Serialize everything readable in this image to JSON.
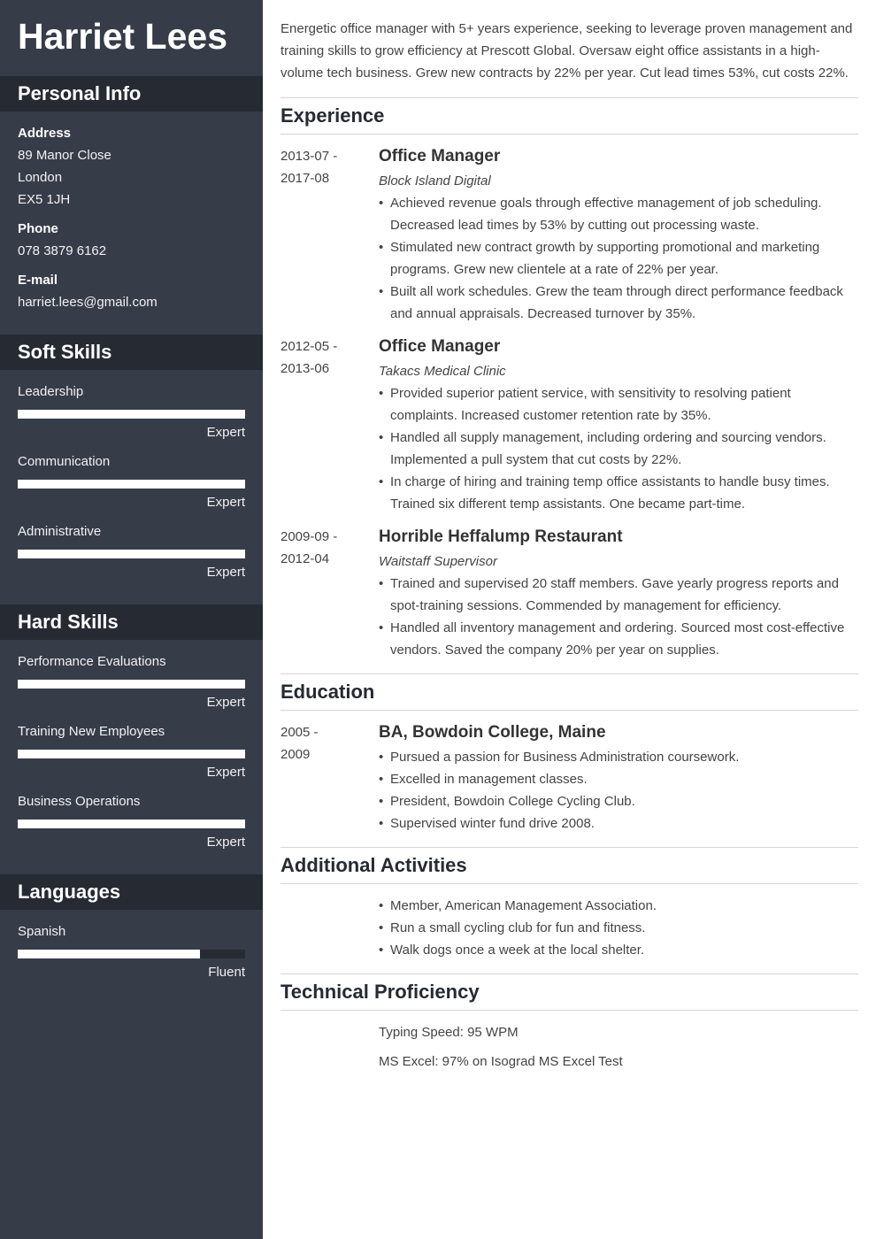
{
  "name": "Harriet Lees",
  "sidebar": {
    "personal_info": {
      "title": "Personal Info",
      "address_label": "Address",
      "address_lines": [
        "89 Manor Close",
        "London",
        "EX5 1JH"
      ],
      "phone_label": "Phone",
      "phone": "078 3879 6162",
      "email_label": "E-mail",
      "email": "harriet.lees@gmail.com"
    },
    "soft_skills": {
      "title": "Soft Skills",
      "items": [
        {
          "name": "Leadership",
          "level": "Expert",
          "fill": 1.0
        },
        {
          "name": "Communication",
          "level": "Expert",
          "fill": 1.0
        },
        {
          "name": "Administrative",
          "level": "Expert",
          "fill": 1.0
        }
      ]
    },
    "hard_skills": {
      "title": "Hard Skills",
      "items": [
        {
          "name": "Performance Evaluations",
          "level": "Expert",
          "fill": 1.0
        },
        {
          "name": "Training New Employees",
          "level": "Expert",
          "fill": 1.0
        },
        {
          "name": "Business Operations",
          "level": "Expert",
          "fill": 1.0
        }
      ]
    },
    "languages": {
      "title": "Languages",
      "items": [
        {
          "name": "Spanish",
          "level": "Fluent",
          "fill": 0.8
        }
      ]
    }
  },
  "summary": "Energetic office manager with 5+ years experience, seeking to leverage proven management and training skills to grow efficiency at Prescott Global. Oversaw eight office assistants in a high-volume tech business. Grew new contracts by 22% per year. Cut lead times 53%, cut costs 22%.",
  "experience": {
    "title": "Experience",
    "entries": [
      {
        "date_start": "2013-07 -",
        "date_end": "2017-08",
        "title": "Office Manager",
        "subtitle": "Block Island Digital",
        "bullets": [
          "Achieved revenue goals through effective management of job scheduling. Decreased lead times by 53% by cutting out processing waste.",
          "Stimulated new contract growth by supporting promotional and marketing programs. Grew new clientele at a rate of 22% per year.",
          "Built all work schedules. Grew the team through direct performance feedback and annual appraisals. Decreased turnover by 35%."
        ]
      },
      {
        "date_start": "2012-05 -",
        "date_end": "2013-06",
        "title": "Office Manager",
        "subtitle": "Takacs Medical Clinic",
        "bullets": [
          "Provided superior patient service, with sensitivity to resolving patient complaints. Increased customer retention rate by 35%.",
          "Handled all supply management, including ordering and sourcing vendors. Implemented a pull system that cut costs by 22%.",
          "In charge of hiring and training temp office assistants to handle busy times. Trained six different temp assistants. One became part-time."
        ]
      },
      {
        "date_start": "2009-09 -",
        "date_end": "2012-04",
        "title": "Horrible Heffalump Restaurant",
        "subtitle": "Waitstaff Supervisor",
        "bullets": [
          "Trained and supervised 20 staff members. Gave yearly progress reports and spot-training sessions. Commended by management for efficiency.",
          "Handled all inventory management and ordering. Sourced most cost-effective vendors. Saved the company 20% per year on supplies."
        ]
      }
    ]
  },
  "education": {
    "title": "Education",
    "entries": [
      {
        "date_start": "2005 -",
        "date_end": "2009",
        "title": "BA, Bowdoin College, Maine",
        "bullets": [
          "Pursued a passion for Business Administration coursework.",
          "Excelled in management classes.",
          "President, Bowdoin College Cycling Club.",
          "Supervised winter fund drive 2008."
        ]
      }
    ]
  },
  "activities": {
    "title": "Additional Activities",
    "bullets": [
      "Member, American Management Association.",
      "Run a small cycling club for fun and fitness.",
      "Walk dogs once a week at the local shelter."
    ]
  },
  "technical": {
    "title": "Technical Proficiency",
    "lines": [
      "Typing Speed: 95 WPM",
      "MS Excel: 97% on Isograd MS Excel Test"
    ]
  }
}
